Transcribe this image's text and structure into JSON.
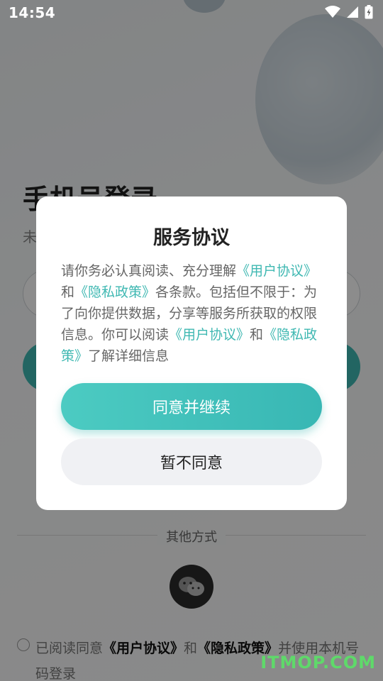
{
  "status_bar": {
    "time": "14:54",
    "icons": [
      "wifi-icon",
      "cellular-signal-icon",
      "battery-charging-icon"
    ]
  },
  "login": {
    "title": "手机号登录",
    "subtitle": "未",
    "other_methods_label": "其他方式",
    "wechat_icon": "wechat-icon",
    "agreement": {
      "prefix": "已阅读同意",
      "user_agreement": "《用户协议》",
      "and": "和",
      "privacy_policy": "《隐私政策》",
      "suffix": "并使用本机号码登录"
    }
  },
  "dialog": {
    "title": "服务协议",
    "body": {
      "p1": "请你务必认真阅读、充分理解",
      "link1": "《用户协议》",
      "p2": "和",
      "link2": "《隐私政策》",
      "p3": "各条款。包括但不限于：为了向你提供数据，分享等服务所获取的权限信息。你可以阅读",
      "link3": "《用户协议》",
      "p4": "和",
      "link4": "《隐私政策》",
      "p5": "了解详细信息"
    },
    "agree_button": "同意并继续",
    "decline_button": "暂不同意"
  },
  "watermark": "ITMOP.COM",
  "colors": {
    "accent": "#3fb8b2",
    "overlay": "rgba(0,0,0,0.45)"
  }
}
